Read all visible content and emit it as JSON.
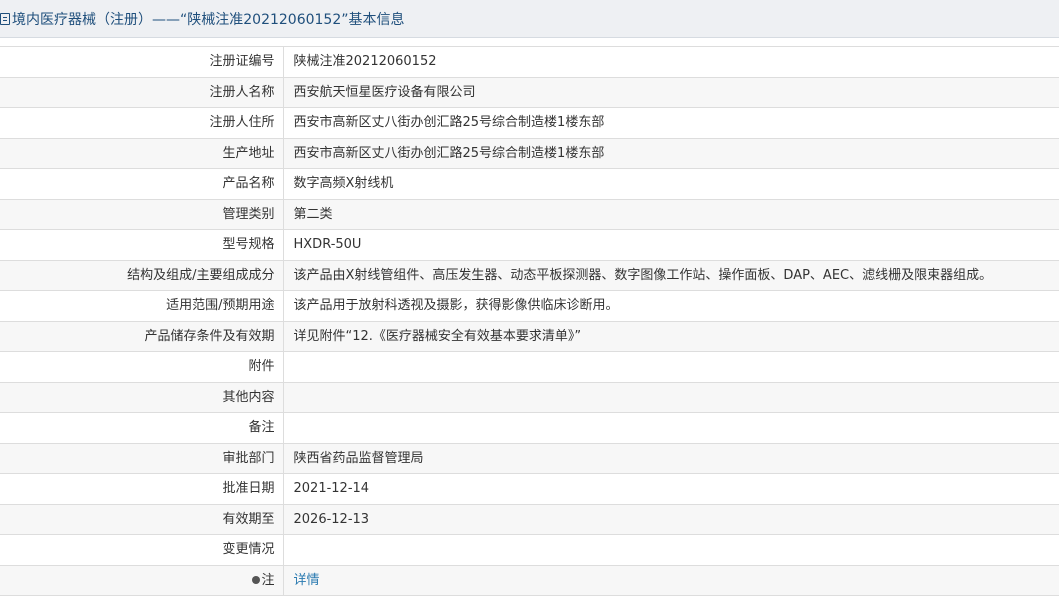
{
  "title": "境内医疗器械（注册）——“陕械注准20212060152”基本信息",
  "rows": [
    {
      "label": "注册证编号",
      "value": "陕械注准20212060152"
    },
    {
      "label": "注册人名称",
      "value": "西安航天恒星医疗设备有限公司"
    },
    {
      "label": "注册人住所",
      "value": "西安市高新区丈八街办创汇路25号综合制造楼1楼东部"
    },
    {
      "label": "生产地址",
      "value": "西安市高新区丈八街办创汇路25号综合制造楼1楼东部"
    },
    {
      "label": "产品名称",
      "value": "数字高频X射线机"
    },
    {
      "label": "管理类别",
      "value": "第二类"
    },
    {
      "label": "型号规格",
      "value": "HXDR-50U"
    },
    {
      "label": "结构及组成/主要组成成分",
      "value": "该产品由X射线管组件、高压发生器、动态平板探测器、数字图像工作站、操作面板、DAP、AEC、滤线栅及限束器组成。"
    },
    {
      "label": "适用范围/预期用途",
      "value": "该产品用于放射科透视及摄影，获得影像供临床诊断用。"
    },
    {
      "label": "产品储存条件及有效期",
      "value": "详见附件“12.《医疗器械安全有效基本要求清单》”"
    },
    {
      "label": "附件",
      "value": ""
    },
    {
      "label": "其他内容",
      "value": ""
    },
    {
      "label": "备注",
      "value": ""
    },
    {
      "label": "审批部门",
      "value": "陕西省药品监督管理局"
    },
    {
      "label": "批准日期",
      "value": "2021-12-14"
    },
    {
      "label": "有效期至",
      "value": "2026-12-13"
    },
    {
      "label": "变更情况",
      "value": ""
    }
  ],
  "note": {
    "label": "注",
    "link_text": "详情"
  }
}
